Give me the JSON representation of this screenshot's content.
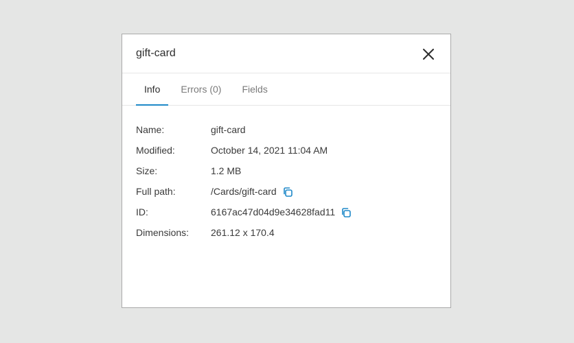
{
  "dialog": {
    "title": "gift-card",
    "close_icon": "close-icon"
  },
  "tabs": [
    {
      "label": "Info",
      "active": true
    },
    {
      "label": "Errors (0)",
      "active": false
    },
    {
      "label": "Fields",
      "active": false
    }
  ],
  "info": {
    "rows": [
      {
        "label": "Name:",
        "value": "gift-card"
      },
      {
        "label": "Modified:",
        "value": "October 14, 2021 11:04 AM"
      },
      {
        "label": "Size:",
        "value": "1.2 MB"
      },
      {
        "label": "Full path:",
        "value": "/Cards/gift-card",
        "copy_icon": "copy-icon"
      },
      {
        "label": "ID:",
        "value": "6167ac47d04d9e34628fad11",
        "copy_icon": "copy-icon"
      },
      {
        "label": "Dimensions:",
        "value": "261.12 x 170.4"
      }
    ]
  },
  "colors": {
    "accent": "#1e88c8",
    "background": "#e5e6e5",
    "dialog_border": "#a9a9a9"
  }
}
